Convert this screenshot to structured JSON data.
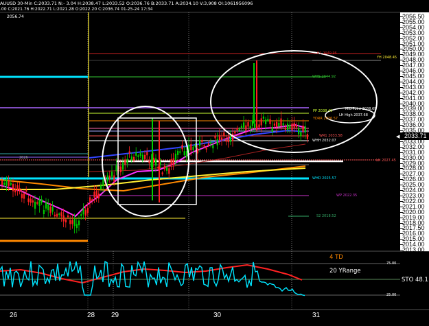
{
  "header": {
    "symbol_line": "AUUSD 30-Min C:2033.71 N:- 3.04 H:2038.47 L:2033.52 O:2036.76 B:2033.71 A:2034.10 V:3,908 OI:1061956096",
    "study_line": ".00  C:2021.76 H:2022.71 L:2021.28 O:2022.20 C:2036.74 01-25-24 17:34",
    "subtitle": "2056.74"
  },
  "price_axis": {
    "ticks": [
      "2056.50",
      "2055.00",
      "2054.00",
      "2053.00",
      "2052.00",
      "2051.00",
      "2050.00",
      "2049.00",
      "2048.00",
      "2047.00",
      "2046.00",
      "2045.00",
      "2044.00",
      "2043.00",
      "2042.00",
      "2041.00",
      "2040.00",
      "2039.00",
      "2038.00",
      "2037.00",
      "2036.00",
      "2035.00",
      "2034.00",
      "2033.00",
      "2032.00",
      "2031.00",
      "2030.00",
      "2029.00",
      "2028.00",
      "2027.00",
      "2026.00",
      "2025.00",
      "2024.00",
      "2023.00",
      "2022.00",
      "2021.00",
      "2020.00",
      "2019.00",
      "2018.00",
      "2017.50",
      "2016.00",
      "2015.00",
      "2014.00",
      "2013.00"
    ],
    "current_price": "2033.71"
  },
  "levels": {
    "yh": "YH 2048.45",
    "r1": "R1 2049.95",
    "whs": "WHS 2044.92",
    "pp": "PP 2038.49",
    "ydr": "YDRR 2036.57",
    "wr1": "WR1 2033.58",
    "whh": "WHH 2032.07",
    "lh": "LH 2027.45",
    "whd": "WHD 2025.57",
    "wp": "WP 2022.35",
    "s2": "S2 2018.52",
    "callout_mid": "Mid-Point 2038.69",
    "callout_lh": "LH High 2037.68",
    "left_label": "2026"
  },
  "oscillator": {
    "ticks": [
      "75.00",
      "25.00"
    ],
    "label_td": "4 TD",
    "label_range": "20 YRange",
    "label_sto": "STO  48.1"
  },
  "dates": [
    "26",
    "28",
    "29",
    "30",
    "31"
  ],
  "colors": {
    "up_candle": "#00cc00",
    "down_candle": "#ff2020",
    "ma_magenta": "#ff33ff",
    "ma_blue": "#3344ff",
    "ma_orange": "#ff8800",
    "ma_yellow": "#ffee33",
    "cyan": "#00e5ff",
    "osc_red": "#ff2222"
  }
}
